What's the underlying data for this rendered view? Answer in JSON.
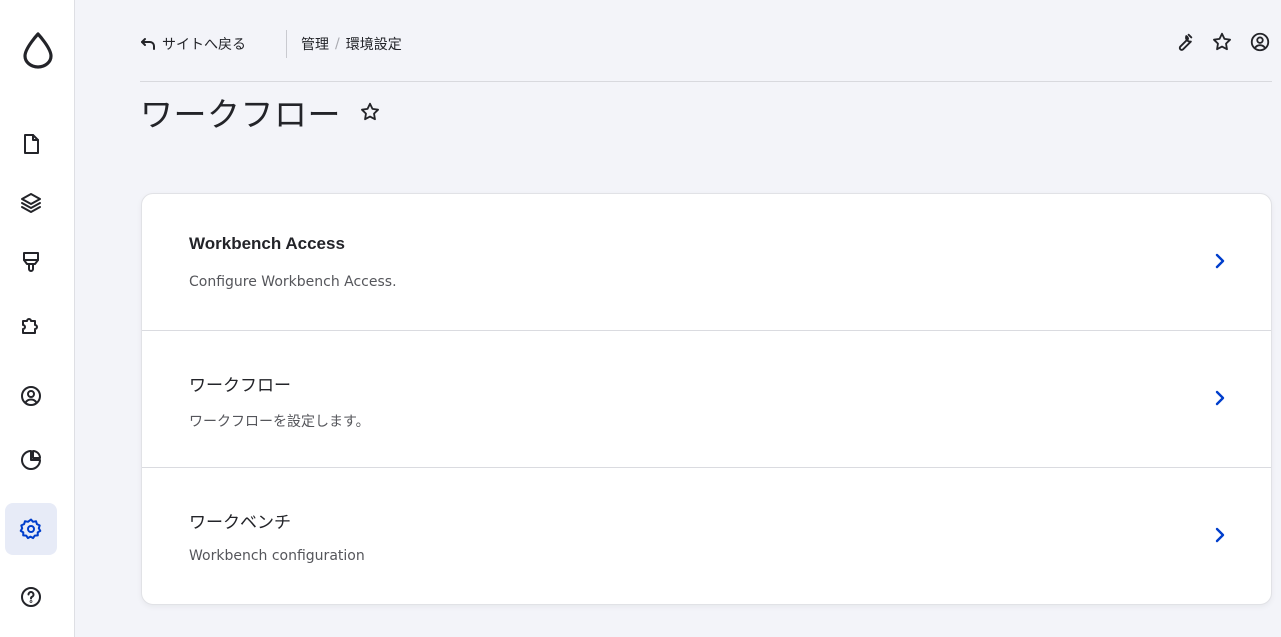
{
  "sidebar": {
    "logo": "drupal-drop-logo",
    "items": [
      {
        "icon": "content-icon",
        "active": false
      },
      {
        "icon": "structure-icon",
        "active": false
      },
      {
        "icon": "appearance-icon",
        "active": false
      },
      {
        "icon": "extend-icon",
        "active": false
      },
      {
        "icon": "people-icon",
        "active": false
      },
      {
        "icon": "reports-icon",
        "active": false
      },
      {
        "icon": "configuration-icon",
        "active": true
      },
      {
        "icon": "help-icon",
        "active": false
      }
    ]
  },
  "topbar": {
    "back_label": "サイトへ戻る",
    "breadcrumb": [
      "管理",
      "環境設定"
    ],
    "tools": [
      "wrench-icon",
      "star-icon",
      "user-icon"
    ]
  },
  "page": {
    "title": "ワークフロー"
  },
  "list": {
    "items": [
      {
        "title": "Workbench Access",
        "description": "Configure Workbench Access."
      },
      {
        "title": "ワークフロー",
        "description": "ワークフローを設定します。"
      },
      {
        "title": "ワークベンチ",
        "description": "Workbench configuration"
      }
    ]
  },
  "colors": {
    "accent": "#003ecc",
    "background": "#f3f4f9",
    "active_nav_bg": "#e7ebf7"
  }
}
